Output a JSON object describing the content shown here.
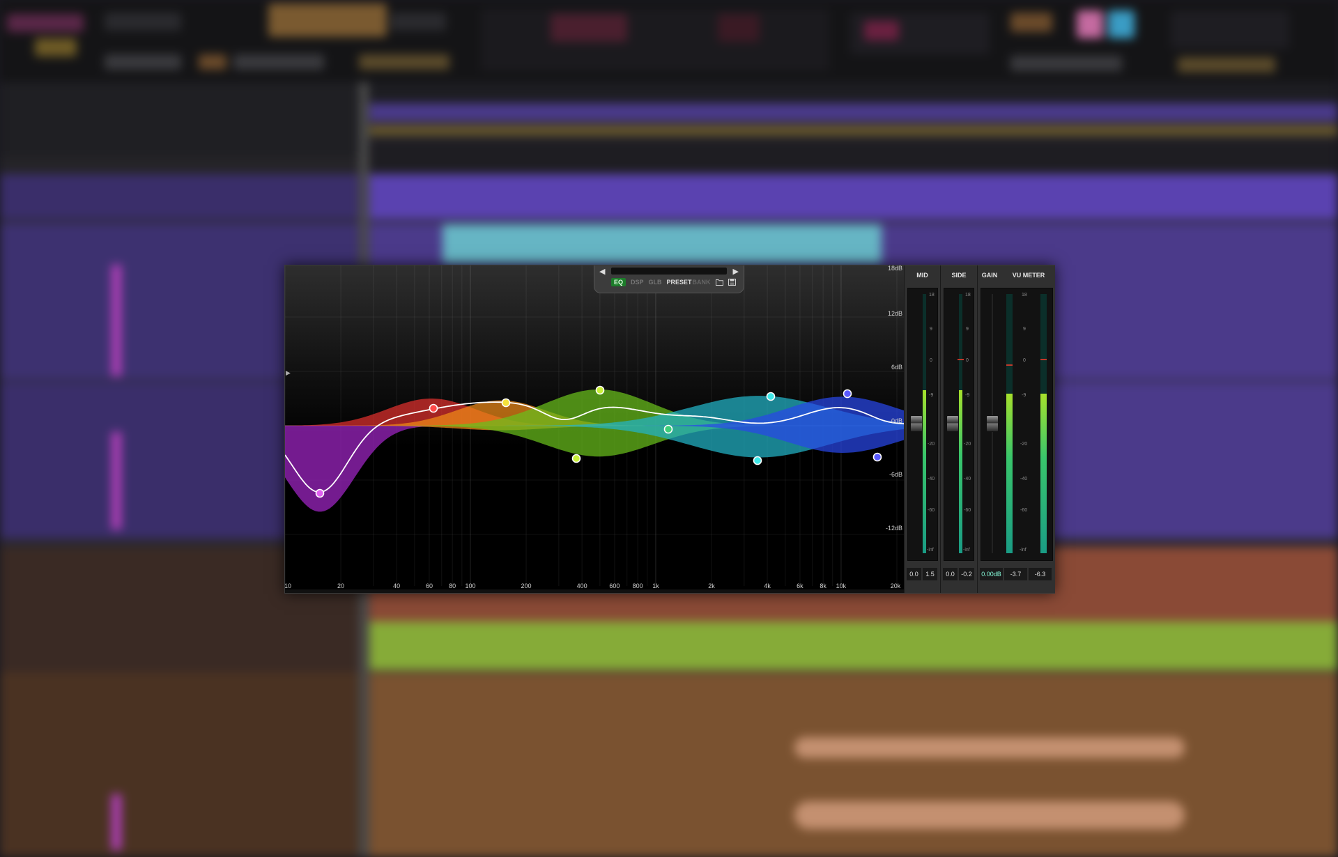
{
  "plugin": {
    "navigation": {
      "prev_symbol": "◀",
      "next_symbol": "▶",
      "tabs": [
        {
          "label": "EQ",
          "active": true
        },
        {
          "label": "DSP",
          "active": false
        },
        {
          "label": "GLB",
          "active": false
        },
        {
          "label": "PRESET",
          "active": false
        },
        {
          "label": "BANK",
          "active": false
        }
      ],
      "icons": [
        "folder-icon",
        "save-icon"
      ]
    },
    "db_labels": [
      "18dB",
      "12dB",
      "6dB",
      "0dB",
      "-6dB",
      "-12dB"
    ],
    "freq_labels": [
      "10",
      "20",
      "40",
      "60",
      "80",
      "100",
      "200",
      "400",
      "600",
      "800",
      "1k",
      "2k",
      "4k",
      "6k",
      "8k",
      "10k",
      "20k"
    ],
    "side_arrow": "▶",
    "bands": [
      {
        "color": "#a125c6",
        "freq": 20,
        "gain": -6
      },
      {
        "color": "#e0312e",
        "freq": 60,
        "gain": 2
      },
      {
        "color": "#f08a18",
        "freq": 150,
        "gain": 2
      },
      {
        "color": "#6abf1c",
        "freq": 500,
        "gain": 3
      },
      {
        "color": "#22b4c8",
        "freq": 4000,
        "gain": 3
      },
      {
        "color": "#2846e8",
        "freq": 10000,
        "gain": 3
      }
    ],
    "handle_colors": {
      "magenta": "#e060f0",
      "red": "#ff4a4a",
      "yellow": "#f5e23a",
      "lime": "#c8f03a",
      "cyan": "#3ee8e8",
      "green": "#3fce7a",
      "blue": "#5a5aff"
    },
    "meters": {
      "mid": {
        "title": "MID",
        "scale": [
          "18",
          "9",
          "0",
          "-9",
          "-20",
          "-40",
          "-60",
          "-inf"
        ],
        "readout_left": "0.0",
        "readout_right": "1.5"
      },
      "side": {
        "title": "SIDE",
        "scale": [
          "18",
          "9",
          "0",
          "-9",
          "-20",
          "-40",
          "-60",
          "-inf"
        ],
        "readout_left": "0.0",
        "readout_right": "-0.2"
      },
      "gain": {
        "title": "GAIN",
        "readout": "0.00dB"
      },
      "vu": {
        "title": "VU METER",
        "scale": [
          "18",
          "9",
          "0",
          "-9",
          "-20",
          "-40",
          "-60",
          "-inf"
        ],
        "readout_left": "-3.7",
        "readout_right": "-6.3"
      }
    }
  },
  "colors": {
    "accent_green": "#1c7d2a",
    "track_purple": "#4d3a8c",
    "clip_cyan": "#66b5c4",
    "track_brown": "#7a4a38",
    "clip_lime": "#86ab38"
  }
}
